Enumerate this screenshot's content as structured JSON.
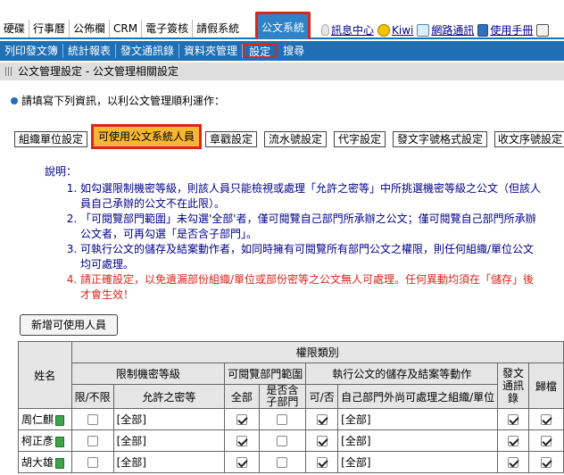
{
  "top_nav": {
    "tabs": [
      "硬碟",
      "行事曆",
      "公佈欄",
      "CRM",
      "電子簽核",
      "請假系統"
    ],
    "active_tab": "公文系統",
    "links": [
      "訊息中心",
      "Kiwi",
      "網路通訊",
      "使用手冊"
    ]
  },
  "sub_menu": {
    "items": [
      "列印發文簿",
      "統計報表",
      "發文通訊錄",
      "資料夾管理",
      "設定",
      "搜尋"
    ],
    "active": "設定"
  },
  "title": "公文管理設定 - 公文管理相關設定",
  "instruction": "請填寫下列資訊，以利公文管理順利運作：",
  "settings_buttons": [
    "組織單位設定",
    "可使用公文系統人員",
    "章戳設定",
    "流水號設定",
    "代字設定",
    "發文字號格式設定",
    "收文序號設定"
  ],
  "active_setting": "可使用公文系統人員",
  "notes": {
    "heading": "說明：",
    "items": [
      "如勾選限制機密等級，則該人員只能檢視或處理「允許之密等」中所挑選機密等級之公文（但該人員自己承辦的公文不在此限）。",
      "「可閱覽部門範圍」未勾選'全部'者，僅可閱覽自己部門所承辦之公文；僅可閱覽自己部門所承辦公文者，可再勾選「是否含子部門」。",
      "可執行公文的儲存及結案動作者，如同時擁有可閱覽所有部門公文之權限，則任何組織/單位公文均可處理。",
      "請正確設定，以免遺漏部份組織/單位或部份密等之公文無人可處理。任何異動均須在「儲存」後才會生效！"
    ]
  },
  "add_button": "新增可使用人員",
  "table": {
    "headers": {
      "name": "姓名",
      "perm_type": "權限類別",
      "secret_group": "限制機密等級",
      "view_group": "可閱覽部門範圍",
      "exec_group": "執行公文的儲存及結案等動作",
      "limit": "限/不限",
      "allowed": "允許之密等",
      "all": "全部",
      "include_sub": "是否含子部門",
      "can": "可/否",
      "own_dept": "自己部門外尚可處理之組織/單位",
      "send_addr": "發文通訊錄",
      "archive": "歸檔"
    },
    "rows": [
      {
        "name": "周仁麒",
        "limit": false,
        "allowed": "[全部]",
        "all": true,
        "sub": false,
        "can": true,
        "other": "[全部]",
        "send": true,
        "archive": true
      },
      {
        "name": "柯正彥",
        "limit": false,
        "allowed": "[全部]",
        "all": true,
        "sub": false,
        "can": true,
        "other": "[全部]",
        "send": true,
        "archive": true
      },
      {
        "name": "胡大雄",
        "limit": false,
        "allowed": "[全部]",
        "all": true,
        "sub": false,
        "can": true,
        "other": "[全部]",
        "send": true,
        "archive": true
      }
    ]
  }
}
